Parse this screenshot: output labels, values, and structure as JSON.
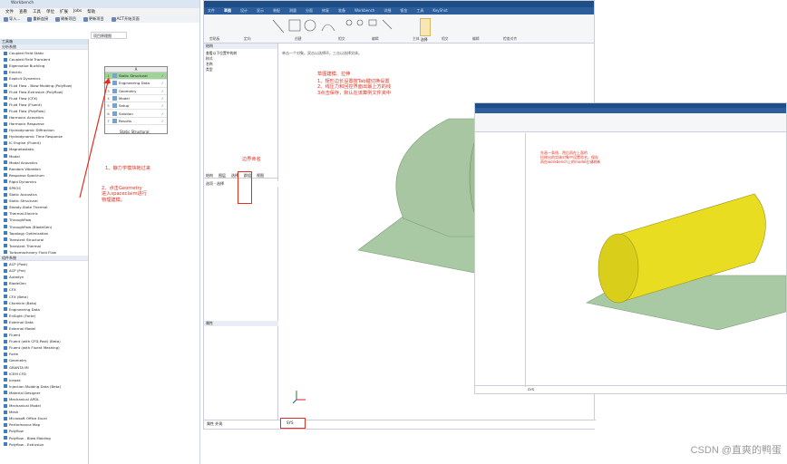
{
  "workbench": {
    "title": "Workbench",
    "menu": [
      "文件",
      "查看",
      "工具",
      "单位",
      "扩展",
      "Jobs",
      "帮助"
    ],
    "toolbar": [
      "导入...",
      "重新连接",
      "刷新项目",
      "更新项目",
      "ACT开始页面"
    ],
    "toolbox_title": "工具箱",
    "group_analysis": "分析系统",
    "analysis_items": [
      "Coupled Field Static",
      "Coupled Field Transient",
      "Eigenvalue Buckling",
      "Electric",
      "Explicit Dynamics",
      "Fluid Flow - Blow Molding (Polyflow)",
      "Fluid Flow-Extrusion (Polyflow)",
      "Fluid Flow (CFX)",
      "Fluid Flow (Fluent)",
      "Fluid Flow (Polyflow)",
      "Harmonic Acoustics",
      "Harmonic Response",
      "Hydrodynamic Diffraction",
      "Hydrodynamic Time Response",
      "IC Engine (Fluent)",
      "Magnetostatic",
      "Modal",
      "Modal Acoustics",
      "Random Vibration",
      "Response Spectrum",
      "Rigid Dynamics",
      "SPEOS",
      "Static Acoustics",
      "Static Structural",
      "Steady-State Thermal",
      "Thermal-Electric",
      "Throughflow",
      "Throughflow (BladeGen)",
      "Topology Optimization",
      "Transient Structural",
      "Transient Thermal",
      "Turbomachinery Fluid Flow"
    ],
    "group_component": "组件系统",
    "component_items": [
      "ACP (Post)",
      "ACP (Pre)",
      "Autodyn",
      "BladeGen",
      "CFX",
      "CFX (Beta)",
      "Chemkin (Beta)",
      "Engineering Data",
      "EnSight (Forte)",
      "External Data",
      "External Model",
      "Fluent",
      "Fluent (with CFD-Post) (Beta)",
      "Fluent (with Fluent Meshing)",
      "Forte",
      "Geometry",
      "GRANTA MI",
      "ICEM CFD",
      "Icepak",
      "Injection Molding Data (Beta)",
      "Material Designer",
      "Mechanical APDL",
      "Mechanical Model",
      "Mesh",
      "Microsoft Office Excel",
      "Performance Map",
      "Polyflow",
      "Polyflow - Blow Molding",
      "Polyflow - Extrusion"
    ],
    "schematic_tab": "项目原理图",
    "system": {
      "letter": "A",
      "rows": [
        {
          "num": "1",
          "label": "Static Structural"
        },
        {
          "num": "2",
          "label": "Engineering Data"
        },
        {
          "num": "3",
          "label": "Geometry"
        },
        {
          "num": "4",
          "label": "Model"
        },
        {
          "num": "5",
          "label": "Setup"
        },
        {
          "num": "6",
          "label": "Solution"
        },
        {
          "num": "7",
          "label": "Results"
        }
      ],
      "caption": "Static Structural"
    },
    "note1": "1、静力学模块拖过来",
    "note2": "2、点击Geometry\n进入spaceclaim进行\n物理建模。"
  },
  "spaceclaim": {
    "tabs": [
      "文件",
      "草图",
      "设计",
      "显示",
      "装配",
      "测量",
      "分面",
      "修复",
      "准备",
      "Workbench",
      "详细",
      "钣金",
      "工具",
      "KeyShot"
    ],
    "ribbon_groups": [
      "剪贴板",
      "定向",
      "创建",
      "相交",
      "编辑",
      "主体",
      "相交",
      "编辑",
      "检查对齐"
    ],
    "select_label": "选择",
    "panel_title": "结构",
    "panel_cols": [
      "查看以下位置中的树",
      "样式",
      "名称",
      "类型"
    ],
    "panel_tabs": [
      "结构",
      "图层",
      "选择",
      "群组",
      "视图"
    ],
    "options_title": "选项 - 选择",
    "props_title": "属性",
    "hint": "单击一个对象。双击以选择环。三击以选择实体。",
    "note_title": "草图建模、拉伸",
    "note_lines": [
      "1、矩形边长设置按Tab键切换设置",
      "2、线压力和回控界面出最上方的线",
      "3点击保存，默认在该算例文件夹中"
    ],
    "label_name": "边界命名",
    "status_left": "属性",
    "status_right": "外观",
    "status_tab": "SYS"
  },
  "screen2": {
    "note": "先画一条线、然后再在上面的\n拉伸出的实体对象中设置命名，保存\n再在workbench上的model右键刷新",
    "status_tab": "SYS"
  },
  "watermark": "CSDN @直爽的鸭蛋"
}
